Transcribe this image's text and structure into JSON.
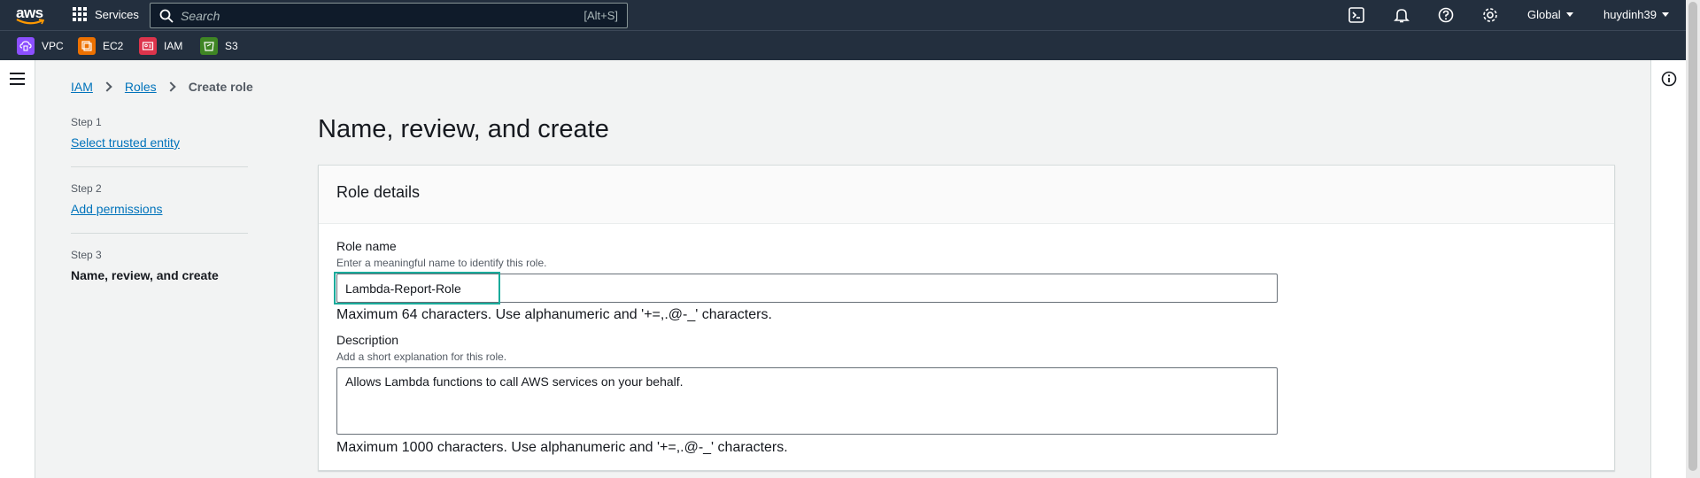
{
  "nav": {
    "logo_text": "aws",
    "services_label": "Services",
    "search_placeholder": "Search",
    "search_shortcut": "[Alt+S]",
    "region_label": "Global",
    "user_label": "huydinh39"
  },
  "favorites": [
    {
      "label": "VPC",
      "color": "#8c4fff"
    },
    {
      "label": "EC2",
      "color": "#ed7100"
    },
    {
      "label": "IAM",
      "color": "#dd344c"
    },
    {
      "label": "S3",
      "color": "#3f8624"
    }
  ],
  "breadcrumb": {
    "items": [
      "IAM",
      "Roles"
    ],
    "current": "Create role"
  },
  "steps": [
    {
      "label": "Step 1",
      "name": "Select trusted entity"
    },
    {
      "label": "Step 2",
      "name": "Add permissions"
    },
    {
      "label": "Step 3",
      "name": "Name, review, and create"
    }
  ],
  "main": {
    "title": "Name, review, and create",
    "panel_title": "Role details",
    "role_name": {
      "label": "Role name",
      "description": "Enter a meaningful name to identify this role.",
      "value": "Lambda-Report-Role",
      "hint": "Maximum 64 characters. Use alphanumeric and '+=,.@-_' characters."
    },
    "description": {
      "label": "Description",
      "description": "Add a short explanation for this role.",
      "value": "Allows Lambda functions to call AWS services on your behalf.",
      "hint": "Maximum 1000 characters. Use alphanumeric and '+=,.@-_' characters."
    }
  }
}
